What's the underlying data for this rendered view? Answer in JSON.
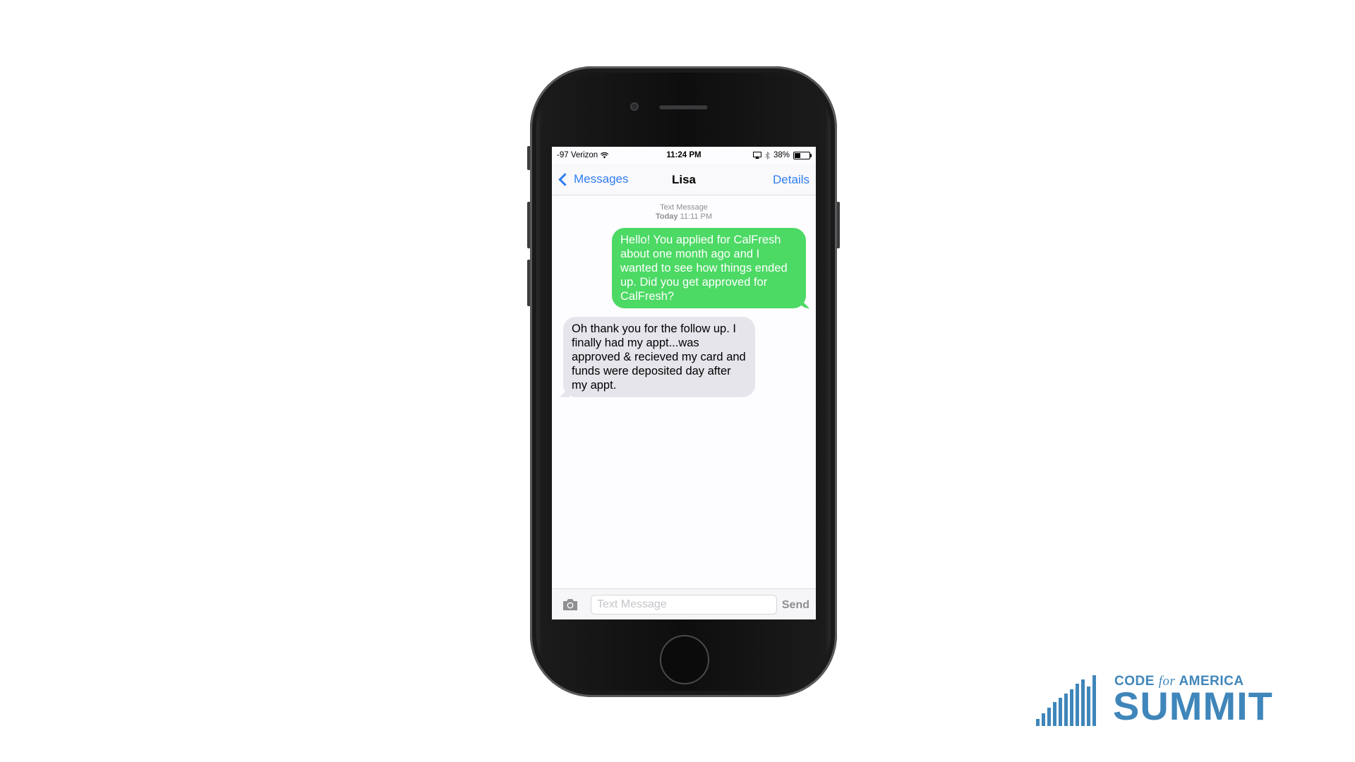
{
  "status_bar": {
    "carrier": "-97 Verizon",
    "time": "11:24 PM",
    "battery": "38%",
    "battery_level": 0.38
  },
  "nav": {
    "back_label": "Messages",
    "title": "Lisa",
    "details_label": "Details"
  },
  "thread": {
    "timestamp_type": "Text Message",
    "timestamp_day": "Today",
    "timestamp_time": "11:11 PM",
    "messages": [
      {
        "direction": "sent",
        "text": "Hello! You applied for CalFresh about one month ago and I wanted to see how things ended up. Did you get approved for CalFresh?"
      },
      {
        "direction": "received",
        "text": "Oh thank you for the follow up. I finally had my appt...was approved & recieved my card and funds were deposited day after my appt."
      }
    ]
  },
  "compose": {
    "placeholder": "Text Message",
    "send_label": "Send"
  },
  "logo": {
    "line1_a": "CODE ",
    "line1_b": "for",
    "line1_c": " AMERICA",
    "line2": "SUMMIT"
  },
  "colors": {
    "accent": "#2f7ef2",
    "sent_bubble": "#4cd964",
    "received_bubble": "#e6e5eb",
    "brand": "#3f86ba"
  },
  "icons": [
    "chevron-left-icon",
    "wifi-icon",
    "airplay-icon",
    "bluetooth-icon",
    "battery-icon",
    "camera-icon"
  ]
}
